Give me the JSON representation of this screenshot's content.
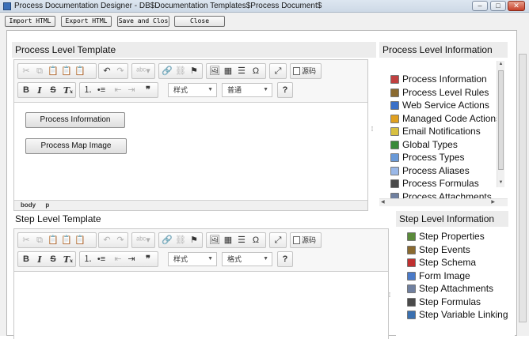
{
  "window": {
    "title": "Process Documentation Designer - DB$Documentation Templates$Process Document$",
    "minimize": "–",
    "maximize": "□",
    "close": "✕"
  },
  "toolbar_buttons": {
    "import_html": "Import HTML",
    "export_html": "Export HTML",
    "save_and_close": "Save and Clos",
    "close": "Close"
  },
  "process_level": {
    "heading": "Process Level Template",
    "style_combo": "样式",
    "format_combo": "普通",
    "source_label": "源码",
    "help_label": "?",
    "content_buttons": [
      "Process Information",
      "Process Map Image"
    ],
    "status_path": [
      "body",
      "p"
    ]
  },
  "process_info": {
    "heading": "Process Level Information",
    "items": [
      {
        "label": "Process Information",
        "icon": "process-information-icon",
        "color": "#c04040"
      },
      {
        "label": "Process Level Rules",
        "icon": "rules-icon",
        "color": "#8a6a30"
      },
      {
        "label": "Web Service Actions",
        "icon": "web-service-icon",
        "color": "#3a70c8"
      },
      {
        "label": "Managed Code Actions",
        "icon": "managed-code-icon",
        "color": "#e0a020"
      },
      {
        "label": "Email Notifications",
        "icon": "email-icon",
        "color": "#d8c040"
      },
      {
        "label": "Global Types",
        "icon": "global-types-icon",
        "color": "#3a8a3a"
      },
      {
        "label": "Process Types",
        "icon": "process-types-icon",
        "color": "#6a9ad8"
      },
      {
        "label": "Process Aliases",
        "icon": "aliases-icon",
        "color": "#9ab8e8"
      },
      {
        "label": "Process Formulas",
        "icon": "formulas-icon",
        "color": "#4a4a4a"
      },
      {
        "label": "Process Attachments",
        "icon": "attachments-icon",
        "color": "#7080a0"
      }
    ]
  },
  "step_level": {
    "heading": "Step Level Template",
    "style_combo": "样式",
    "format_combo": "格式",
    "source_label": "源码",
    "help_label": "?"
  },
  "step_info": {
    "heading": "Step Level Information",
    "items": [
      {
        "label": "Step Properties",
        "icon": "step-properties-icon",
        "color": "#5a8a3a"
      },
      {
        "label": "Step Events",
        "icon": "step-events-icon",
        "color": "#8a6a30"
      },
      {
        "label": "Step Schema",
        "icon": "step-schema-icon",
        "color": "#c03030"
      },
      {
        "label": "Form Image",
        "icon": "form-image-icon",
        "color": "#4a7ac8"
      },
      {
        "label": "Step Attachments",
        "icon": "step-attachments-icon",
        "color": "#7080a0"
      },
      {
        "label": "Step Formulas",
        "icon": "step-formulas-icon",
        "color": "#4a4a4a"
      },
      {
        "label": "Step Variable Linking",
        "icon": "variable-linking-icon",
        "color": "#3a70b0"
      }
    ]
  }
}
